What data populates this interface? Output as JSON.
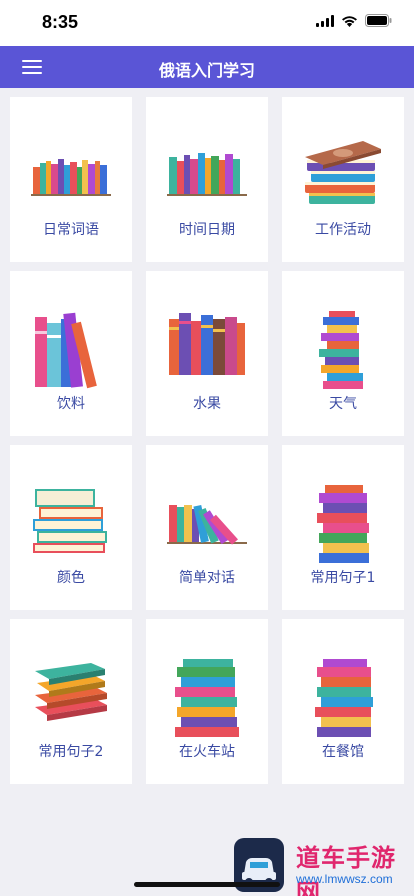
{
  "status_bar": {
    "time": "8:35"
  },
  "navbar": {
    "title": "俄语入门学习"
  },
  "categories": [
    {
      "label": "日常词语",
      "icon": "books-row-icon"
    },
    {
      "label": "时间日期",
      "icon": "books-row-icon"
    },
    {
      "label": "工作活动",
      "icon": "books-stack-icon"
    },
    {
      "label": "饮料",
      "icon": "books-row-icon"
    },
    {
      "label": "水果",
      "icon": "books-row-icon"
    },
    {
      "label": "天气",
      "icon": "books-stack-icon"
    },
    {
      "label": "颜色",
      "icon": "books-stack-icon"
    },
    {
      "label": "简单对话",
      "icon": "books-leaning-icon"
    },
    {
      "label": "常用句子1",
      "icon": "books-stack-icon"
    },
    {
      "label": "常用句子2",
      "icon": "books-stack-icon"
    },
    {
      "label": "在火车站",
      "icon": "books-stack-icon"
    },
    {
      "label": "在餐馆",
      "icon": "books-stack-icon"
    }
  ],
  "watermark": {
    "text": "道车手游网",
    "url": "www.lmwwsz.com"
  },
  "colors": {
    "accent": "#5a55d6",
    "label": "#3a4aa3",
    "background": "#efeff4"
  }
}
